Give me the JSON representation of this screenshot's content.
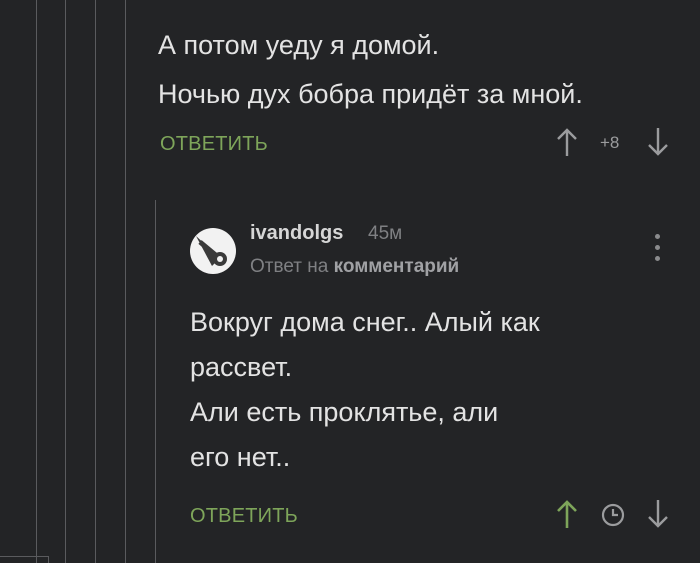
{
  "top_comment": {
    "lines": [
      "А потом уеду я домой.",
      "Ночью дух бобра придёт за мной."
    ],
    "reply_label": "ОТВЕТИТЬ",
    "rating": "+8"
  },
  "reply_comment": {
    "username": "ivandolgs",
    "time": "45м",
    "subline_prefix": "Ответ на",
    "subline_link": "комментарий",
    "lines": [
      "Вокруг дома снег.. Алый как",
      "рассвет.",
      "Али есть проклятье, али",
      "его нет.."
    ],
    "reply_label": "ОТВЕТИТЬ"
  },
  "colors": {
    "background": "#232426",
    "accent_green": "#7ea55a",
    "muted": "#7f8083"
  },
  "icons": [
    "upvote-arrow-icon",
    "downvote-arrow-icon",
    "clock-icon",
    "more-vertical-icon",
    "user-avatar-icon"
  ]
}
